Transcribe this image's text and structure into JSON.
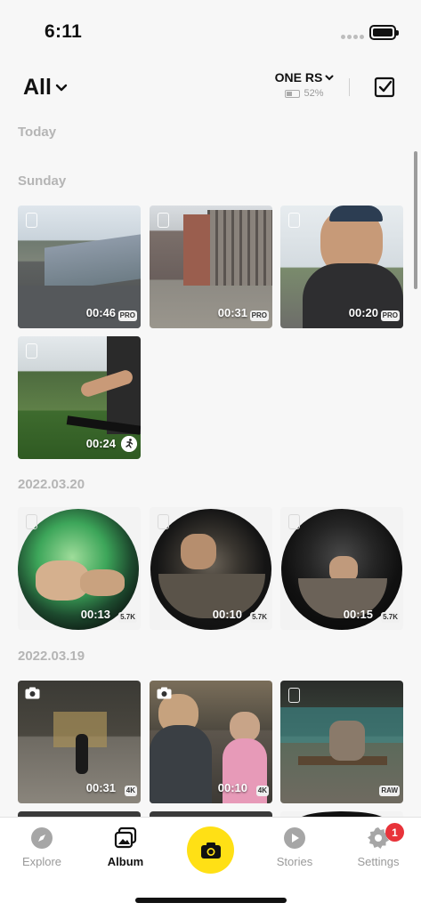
{
  "status_bar": {
    "time": "6:11"
  },
  "header": {
    "filter_label": "All",
    "camera_name": "ONE RS",
    "camera_battery": "52%"
  },
  "sections": [
    {
      "label": "Today"
    },
    {
      "label": "Sunday"
    },
    {
      "label": "2022.03.20"
    },
    {
      "label": "2022.03.19"
    }
  ],
  "thumbnails": [
    {
      "duration": "00:46",
      "badge": "PRO",
      "mode": "video",
      "icon": "video-icon"
    },
    {
      "duration": "00:31",
      "badge": "PRO",
      "mode": "video",
      "icon": "video-icon"
    },
    {
      "duration": "00:20",
      "badge": "PRO",
      "mode": "video",
      "icon": "video-icon"
    },
    {
      "duration": "00:24",
      "badge": "",
      "mode": "video",
      "icon": "run-icon"
    },
    {
      "duration": "00:13",
      "badge": "5.7K",
      "mode": "360",
      "icon": "video-icon"
    },
    {
      "duration": "00:10",
      "badge": "5.7K",
      "mode": "360",
      "icon": "video-icon"
    },
    {
      "duration": "00:15",
      "badge": "5.7K",
      "mode": "360",
      "icon": "video-icon"
    },
    {
      "duration": "00:31",
      "badge": "4K",
      "mode": "photo",
      "icon": "camera-icon"
    },
    {
      "duration": "00:10",
      "badge": "4K",
      "mode": "photo",
      "icon": "camera-icon"
    },
    {
      "duration": "",
      "badge": "RAW",
      "mode": "video",
      "icon": "video-icon"
    }
  ],
  "tab_bar": {
    "tabs": [
      {
        "label": "Explore",
        "icon": "compass-icon",
        "active": false
      },
      {
        "label": "Album",
        "icon": "album-icon",
        "active": true
      },
      {
        "label": "",
        "icon": "camera-shutter-icon",
        "active": false
      },
      {
        "label": "Stories",
        "icon": "play-icon",
        "active": false
      },
      {
        "label": "Settings",
        "icon": "gear-icon",
        "active": false
      }
    ],
    "settings_badge": "1"
  },
  "colors": {
    "accent": "#ffe015",
    "notification": "#e8333a",
    "section_label": "#b5b5b5"
  }
}
